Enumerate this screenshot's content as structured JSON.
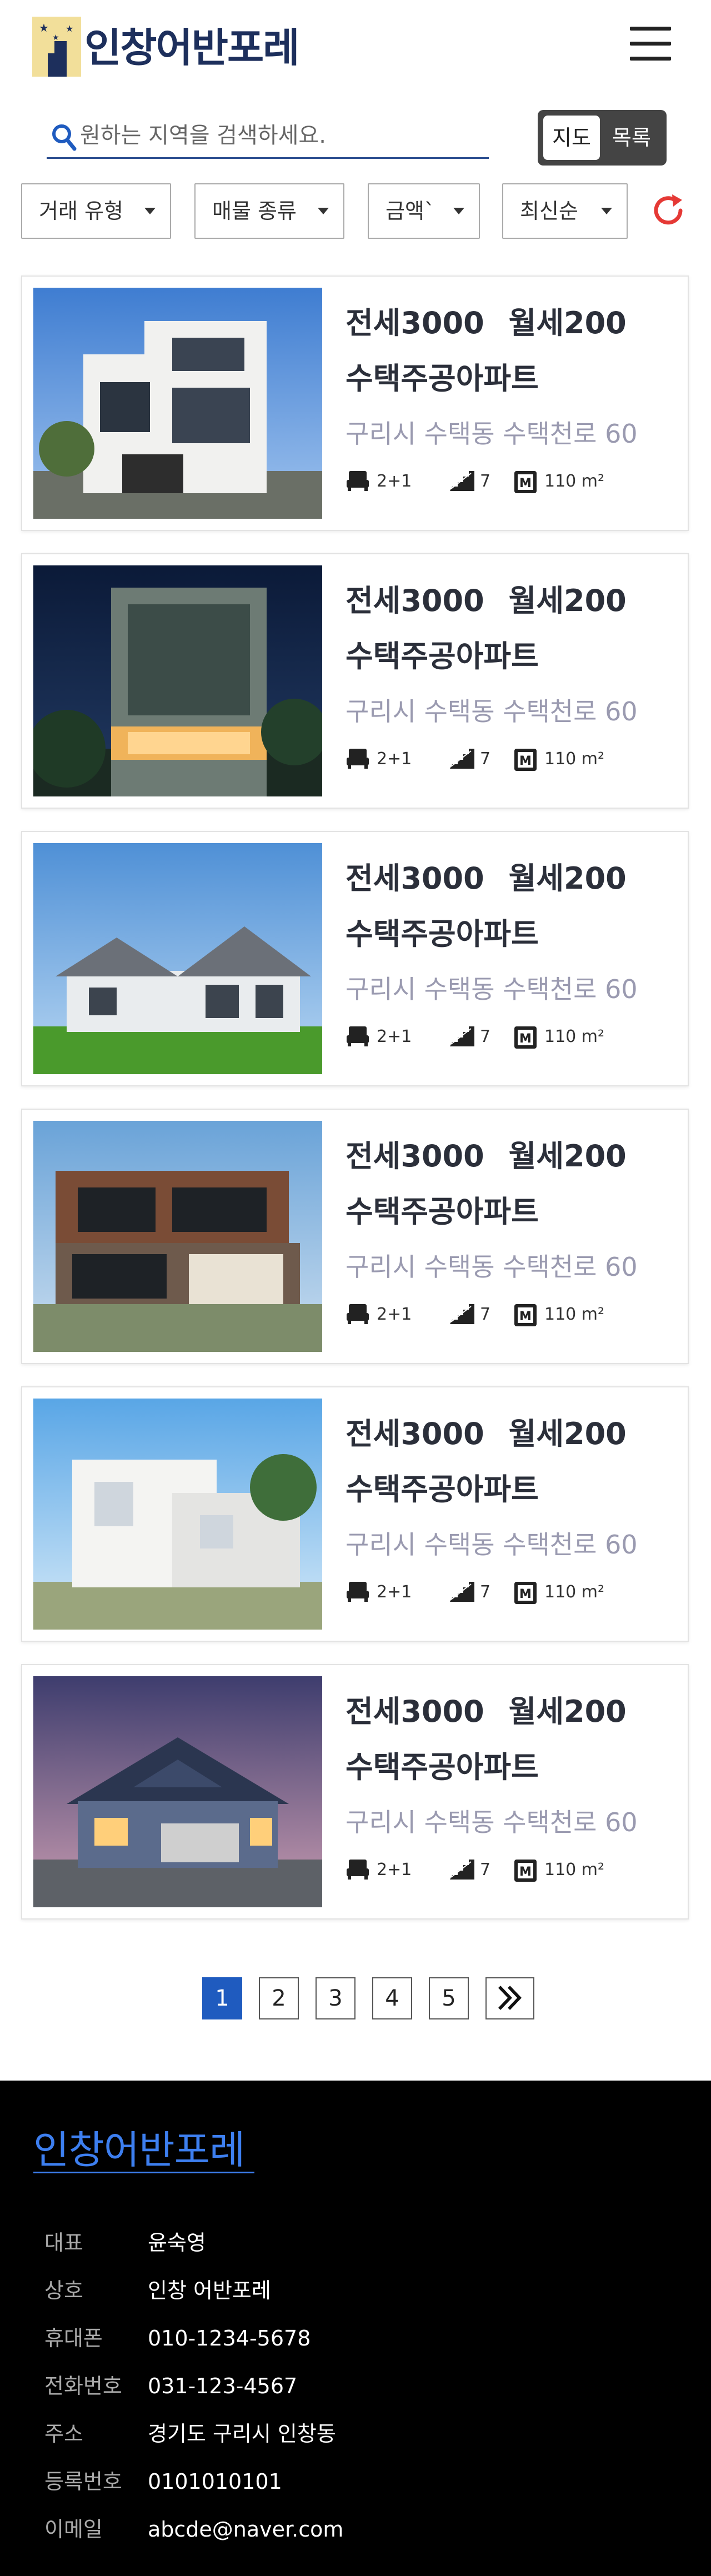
{
  "header": {
    "logo_text": "인창어반포레"
  },
  "search": {
    "placeholder": "원하는 지역을 검색하세요."
  },
  "view_toggle": {
    "map": "지도",
    "list": "목록"
  },
  "filters": {
    "deal_type": "거래 유형",
    "property_type": "매물 종류",
    "price": "금액`",
    "sort": "최신순"
  },
  "listings": [
    {
      "price_jeonse": "전세3000",
      "price_monthly": "월세200",
      "type": "수택주공아파트",
      "address": "구리시 수택동 수택천로 60",
      "rooms": "2+1",
      "floor": "7",
      "area": "110 m²"
    },
    {
      "price_jeonse": "전세3000",
      "price_monthly": "월세200",
      "type": "수택주공아파트",
      "address": "구리시 수택동 수택천로 60",
      "rooms": "2+1",
      "floor": "7",
      "area": "110 m²"
    },
    {
      "price_jeonse": "전세3000",
      "price_monthly": "월세200",
      "type": "수택주공아파트",
      "address": "구리시 수택동 수택천로 60",
      "rooms": "2+1",
      "floor": "7",
      "area": "110 m²"
    },
    {
      "price_jeonse": "전세3000",
      "price_monthly": "월세200",
      "type": "수택주공아파트",
      "address": "구리시 수택동 수택천로 60",
      "rooms": "2+1",
      "floor": "7",
      "area": "110 m²"
    },
    {
      "price_jeonse": "전세3000",
      "price_monthly": "월세200",
      "type": "수택주공아파트",
      "address": "구리시 수택동 수택천로 60",
      "rooms": "2+1",
      "floor": "7",
      "area": "110 m²"
    },
    {
      "price_jeonse": "전세3000",
      "price_monthly": "월세200",
      "type": "수택주공아파트",
      "address": "구리시 수택동 수택천로 60",
      "rooms": "2+1",
      "floor": "7",
      "area": "110 m²"
    }
  ],
  "pagination": {
    "pages": [
      "1",
      "2",
      "3",
      "4",
      "5"
    ],
    "active": "1",
    "next_icon": "double-chevron-right-icon"
  },
  "footer": {
    "title": "인창어반포레",
    "rows": [
      {
        "label": "대표",
        "value": "윤숙영"
      },
      {
        "label": "상호",
        "value": "인창 어반포레"
      },
      {
        "label": "휴대폰",
        "value": "010-1234-5678"
      },
      {
        "label": "전화번호",
        "value": "031-123-4567"
      },
      {
        "label": "주소",
        "value": "경기도 구리시 인창동"
      },
      {
        "label": "등록번호",
        "value": "0101010101"
      },
      {
        "label": "이메일",
        "value": "abcde@naver.com"
      }
    ]
  },
  "colors": {
    "brand_navy": "#1d2f5c",
    "accent_blue": "#1f5bbf",
    "footer_blue": "#3d7ff0",
    "refresh_red": "#e53935"
  }
}
